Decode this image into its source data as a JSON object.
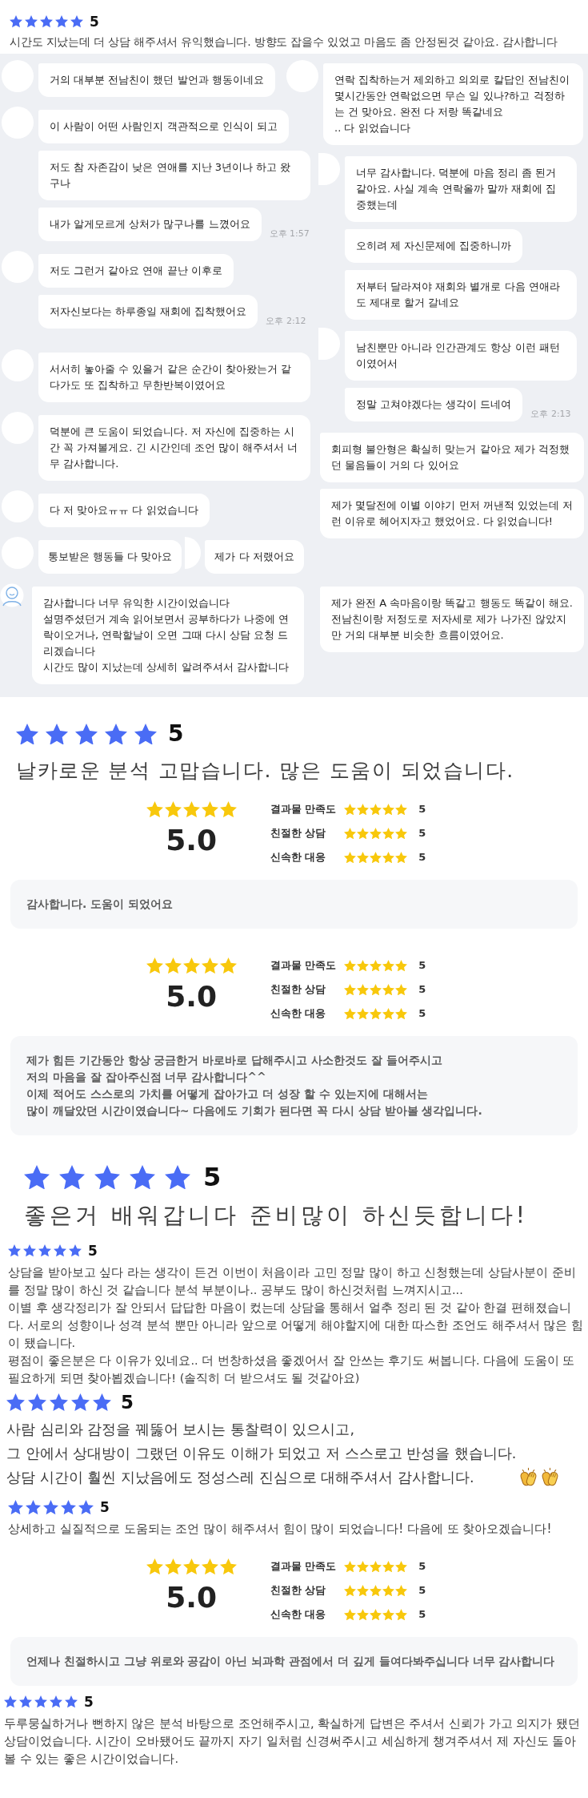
{
  "sections": [
    {
      "kind": "review",
      "stars": 5,
      "score": "5",
      "text": "시간도 지났는데 더 상담 해주셔서 유익했습니다. 방향도 잡을수 있었고 마음도 좀 안정된것 같아요. 감사합니다"
    },
    {
      "kind": "chat",
      "columns": [
        {
          "groups": [
            {
              "kind": "avatar",
              "messages": [
                {
                  "text": "거의 대부분 전남친이 했던 발언과 행동이네요"
                }
              ]
            },
            {
              "kind": "avatar",
              "messages": [
                {
                  "text": "이 사람이 어떤 사람인지 객관적으로 인식이 되고"
                },
                {
                  "text": "저도 참 자존감이 낮은 연애를 지난 3년이나 하고 왔구나"
                },
                {
                  "text": "내가 알게모르게 상처가 많구나를 느꼈어요",
                  "time": "오후 1:57"
                }
              ]
            },
            {
              "kind": "avatar",
              "messages": [
                {
                  "text": "저도 그런거 같아요 연애 끝난 이후로"
                },
                {
                  "text": "저자신보다는 하루종일 재회에 집착했어요",
                  "time": "오후 2:12"
                }
              ]
            },
            {
              "kind": "avatar",
              "messages": [
                {
                  "text": "서서히 놓아줄 수 있을거 같은 순간이 찾아왔는거 같다가도 또 집착하고 무한반복이였어요"
                }
              ]
            },
            {
              "kind": "avatar",
              "messages": [
                {
                  "text": "덕분에 큰 도움이 되었습니다. 저 자신에 집중하는 시간 꼭 가져볼게요. 긴 시간인데 조언 많이 해주셔서 너무 감사합니다."
                }
              ]
            },
            {
              "kind": "avatar",
              "messages": [
                {
                  "text": "다 저 맞아요ㅠㅠ 다 읽었습니다"
                }
              ]
            },
            {
              "kind": "avatar",
              "messages": [
                {
                  "text": "통보받은 행동들 다 맞아요"
                }
              ],
              "beside": {
                "kind": "cut_avatar",
                "messages": [
                  {
                    "text": "제가 다 저랬어요"
                  }
                ]
              }
            },
            {
              "kind": "person_avatar",
              "messages": [
                {
                  "text": "감사합니다 너무 유익한 시간이었습니다\n설명주셨던거 계속 읽어보면서 공부하다가 나중에 연락이오거나, 연락할날이 오면 그때 다시 상담 요청 드리겠습니다\n시간도 많이 지났는데 상세히 알려주셔서 감사합니다"
                }
              ]
            }
          ]
        },
        {
          "groups": [
            {
              "kind": "avatar",
              "messages": [
                {
                  "text": "연락 집착하는거 제외하고 의외로 칼답인 전남친이 몇시간동안 연락없으면 무슨 일 있나?하고 걱정하는 건 맞아요. 완전 다 저랑 똑같네요\n.. 다 읽었습니다"
                }
              ]
            },
            {
              "kind": "cut_avatar",
              "messages": [
                {
                  "text": "너무 감사합니다. 덕분에 마음 정리 좀 된거 같아요. 사실 계속 연락올까 말까 재회에 집중했는데"
                },
                {
                  "text": "오히려 제 자신문제에 집중하니까"
                },
                {
                  "text": "저부터 달라져야 재회와 별개로 다음 연애라도 제대로 할거 갈네요"
                }
              ]
            },
            {
              "kind": "cut_avatar",
              "messages": [
                {
                  "text": "남친뿐만 아니라 인간관계도 항상 이런 패턴이였어서"
                },
                {
                  "text": "정말 고쳐야겠다는 생각이 드네여",
                  "time": "오후 2:13"
                }
              ]
            },
            {
              "kind": "plain",
              "messages": [
                {
                  "text": "회피형 불안형은 확실히 맞는거 같아요 제가 걱정했던 물음들이 거의 다 있어요"
                }
              ]
            },
            {
              "kind": "plain",
              "messages": [
                {
                  "text": "제가 몇달전에 이별 이야기 먼저 꺼낸적 있었는데 저런 이유로 헤어지자고 했었어요. 다 읽었습니다!"
                }
              ]
            },
            {
              "kind": "plain",
              "messages": [
                {
                  "text": "제가 완전 A 속마음이랑 똑같고 행동도 똑같이 해요. 전남친이랑 저정도로 저자세로 제가 나가진 않았지만 거의 대부분 비슷한 흐름이였어요."
                }
              ]
            }
          ]
        }
      ]
    },
    {
      "kind": "headline",
      "stars": 5,
      "score": "5",
      "text": "날카로운 분석 고맙습니다. 많은 도움이 되었습니다."
    },
    {
      "kind": "rating_card",
      "stars": 5,
      "score": "5.0",
      "criteria": [
        {
          "label": "결과물 만족도",
          "stars": 5,
          "score": "5"
        },
        {
          "label": "친절한 상담",
          "stars": 5,
          "score": "5"
        },
        {
          "label": "신속한 대응",
          "stars": 5,
          "score": "5"
        }
      ],
      "comment": "감사합니다. 도움이 되었어요"
    },
    {
      "kind": "rating_card",
      "stars": 5,
      "score": "5.0",
      "criteria": [
        {
          "label": "결과물 만족도",
          "stars": 5,
          "score": "5"
        },
        {
          "label": "친절한 상담",
          "stars": 5,
          "score": "5"
        },
        {
          "label": "신속한 대응",
          "stars": 5,
          "score": "5"
        }
      ],
      "comment": "제가 힘든 기간동안 항상 궁금한거 바로바로 답해주시고 사소한것도 잘 들어주시고\n저의 마음을 잘 잡아주신점 너무 감사합니다^^\n이제 적어도 스스로의 가치를 어떻게 잡아가고 더 성장 할 수 있는지에 대해서는\n많이 깨달았던 시간이였습니다~ 다음에도 기회가 된다면 꼭 다시 상담 받아볼 생각입니다."
    },
    {
      "kind": "headline",
      "stars": 5,
      "score": "5",
      "text": "좋은거 배워갑니다 준비많이 하신듯합니다!"
    },
    {
      "kind": "review",
      "stars": 5,
      "score": "5",
      "text": "상담을 받아보고 싶다 라는 생각이 든건 이번이 처음이라 고민 정말 많이 하고 신청했는데 상담사분이 준비를 정말 많이 하신 것 같습니다 분석 부분이나.. 공부도 많이 하신것처럼 느껴지시고...\n이별 후 생각정리가 잘 안되서 답답한 마음이 컸는데 상담을 통해서 얼추 정리 된 것 같아 한결 편해졌습니다. 서로의 성향이나 성격 분석 뿐만 아니라 앞으로 어떻게 해야할지에 대한 따스한 조언도 해주셔서 많은 힘이 됐습니다.\n평점이 좋은분은 다 이유가 있네요.. 더 번창하셨음 좋겠어서 잘 안쓰는 후기도 써봅니다. 다음에 도움이 또 필요하게 되면 찾아뵙겠습니다! (솔직히 더 받으셔도 될 것같아요)"
    },
    {
      "kind": "statement",
      "stars": 5,
      "score": "5",
      "text": "사람 심리와 감정을 꿰뚫어 보시는 통찰력이 있으시고,\n그 안에서 상대방이 그랬던 이유도 이해가 되었고 저 스스로고 반성을 했습니다.\n상담 시간이 훨씬 지났음에도 정성스레 진심으로 대해주셔서 감사합니다.",
      "icons": [
        {
          "kind": "clapping_hands"
        },
        {
          "kind": "clapping_hands"
        }
      ]
    },
    {
      "kind": "review",
      "stars": 5,
      "score": "5",
      "text": "상세하고 실질적으로 도움되는 조언 많이 해주셔서 힘이 많이 되었습니다! 다음에 또 찾아오겠습니다!"
    },
    {
      "kind": "rating_card",
      "stars": 5,
      "score": "5.0",
      "criteria": [
        {
          "label": "결과물 만족도",
          "stars": 5,
          "score": "5"
        },
        {
          "label": "친절한 상담",
          "stars": 5,
          "score": "5"
        },
        {
          "label": "신속한 대응",
          "stars": 5,
          "score": "5"
        }
      ],
      "comment": "언제나 친절하시고 그냥 위로와 공감이 아닌 뇌과학 관점에서 더 깊게 들여다봐주십니다 너무 감사합니다"
    },
    {
      "kind": "review",
      "stars": 5,
      "score": "5",
      "text": "두루뭉실하거나 뻔하지 않은 분석 바탕으로 조언해주시고, 확실하게 답변은 주셔서 신뢰가 가고 의지가 됐던 상담이었습니다. 시간이 오바됐어도 끝까지 자기 일처럼 신경써주시고 세심하게 챙겨주셔서 제 자신도 돌아볼 수 있는 좋은 시간이었습니다."
    }
  ]
}
